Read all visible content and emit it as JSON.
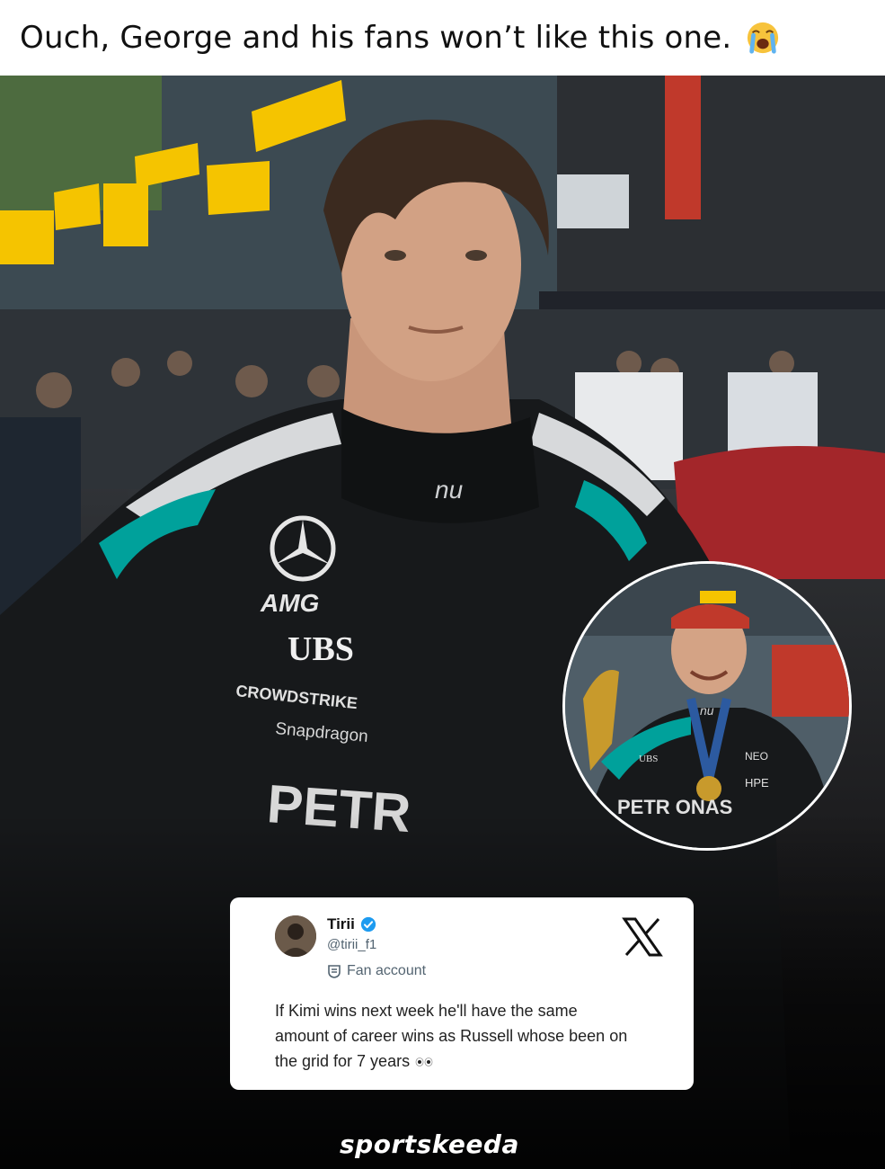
{
  "caption": {
    "text": "Ouch, George and his fans won’t like this one.",
    "emoji": "loudly-crying-face-icon"
  },
  "photo": {
    "suit_labels": {
      "amg": "AMG",
      "ubs": "UBS",
      "crowdstrike": "CROWDSTRIKE",
      "snapdragon": "Snapdragon",
      "petronas": "PETR",
      "collar": "nu"
    },
    "inset_labels": {
      "petronas": "PETR  ONAS",
      "neo": "NEO",
      "hpe": "HPE",
      "ubs": "UBS",
      "collar": "nu"
    }
  },
  "tweet": {
    "name": "Tirii",
    "handle": "@tirii_f1",
    "badge": "Fan account",
    "text": "If Kimi wins next week he'll have the same amount of career wins as Russell whose been on the grid for 7 years",
    "platform_icon": "x-logo-icon",
    "verified_icon": "verified-badge-icon"
  },
  "brand": {
    "name": "sportskeeda"
  },
  "colors": {
    "accent_teal": "#00a19b",
    "verified_blue": "#1d9bf0",
    "dhl_yellow": "#f5c400"
  }
}
